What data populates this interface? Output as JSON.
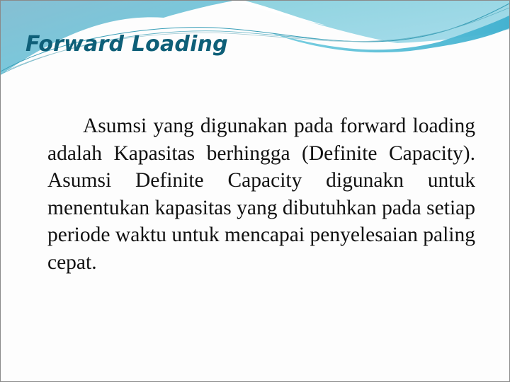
{
  "slide": {
    "title": "Forward Loading",
    "body": "Asumsi yang digunakan pada forward loading adalah Kapasitas berhingga (Definite Capacity). Asumsi Definite Capacity digunakn untuk menentukan kapasitas yang dibutuhkan pada setiap periode waktu untuk mencapai penyelesaian paling cepat."
  },
  "theme": {
    "title_color": "#0e5f78",
    "wave_light": "#9fd6e6",
    "wave_mid": "#6ec9dd",
    "wave_dark": "#3fb3d0",
    "border_color": "#8a8a8a"
  }
}
